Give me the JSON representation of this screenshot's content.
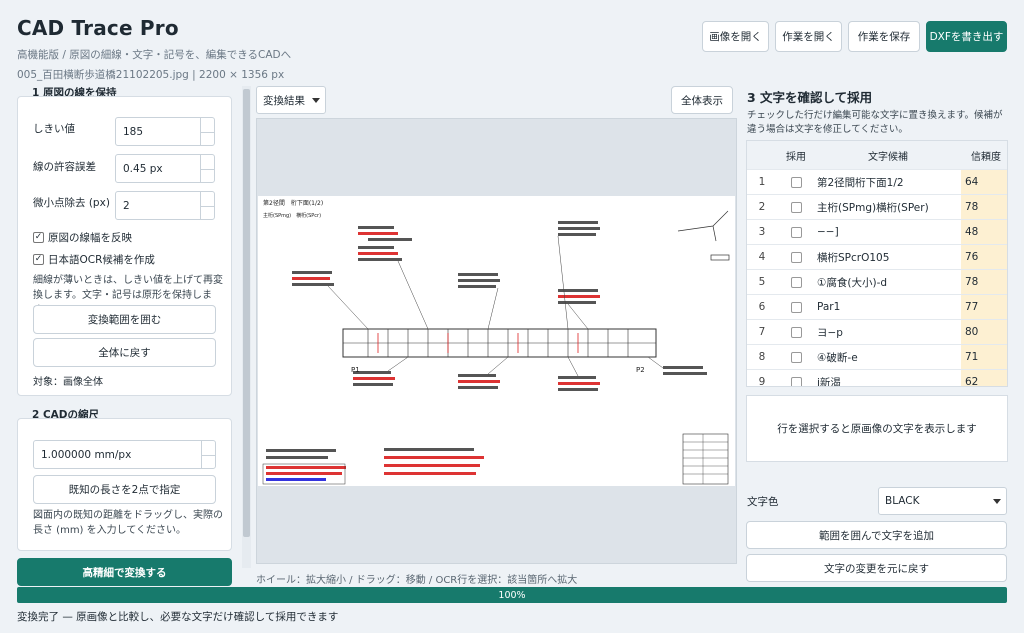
{
  "app": {
    "title": "CAD Trace Pro",
    "subtitle": "高機能版 / 原図の細線・文字・記号を、編集できるCADへ",
    "fileinfo": "005_百田横断歩道橋21102205.jpg | 2200 × 1356 px"
  },
  "toolbar": {
    "open_image": "画像を開く",
    "open_work": "作業を開く",
    "save_work": "作業を保存",
    "export_dxf": "DXFを書き出す"
  },
  "section1": {
    "title": "1 原図の線を保持",
    "threshold_label": "しきい値",
    "threshold_value": "185",
    "tolerance_label": "線の許容誤差",
    "tolerance_value": "0.45 px",
    "speck_label": "微小点除去 (px)",
    "speck_value": "2",
    "invert_label": "原図の線幅を反映",
    "ocr_label": "日本語OCR候補を作成",
    "note": "細線が薄いときは、しきい値を上げて再変換します。文字・記号は原形を保持します。",
    "select_region": "変換範囲を囲む",
    "reset_all": "全体に戻す",
    "target": "対象：画像全体"
  },
  "section2": {
    "title": "2 CADの縮尺",
    "scale_value": "1.000000 mm/px",
    "two_point": "既知の長さを2点で指定",
    "note": "図面内の既知の距離をドラッグし、実際の長さ (mm) を入力してください。"
  },
  "convert_button": "高精細で変換する",
  "viewer": {
    "mode": "変換結果",
    "fit": "全体表示",
    "hint": "ホイール：拡大縮小 / ドラッグ：移動 / OCR行を選択：該当箇所へ拡大"
  },
  "section3": {
    "title": "3 文字を確認して採用",
    "desc": "チェックした行だけ編集可能な文字に置き換えます。候補が違う場合は文字を修正してください。",
    "headers": {
      "adopt": "採用",
      "text": "文字候補",
      "conf": "信頼度"
    },
    "rows": [
      {
        "n": "1",
        "text": "第2径間桁下面1/2",
        "conf": "64"
      },
      {
        "n": "2",
        "text": "主桁(SPmg)横桁(SPer)",
        "conf": "78"
      },
      {
        "n": "3",
        "text": "−−]",
        "conf": "48"
      },
      {
        "n": "4",
        "text": "横桁SPcrO105",
        "conf": "76"
      },
      {
        "n": "5",
        "text": "①腐食(大小)-d",
        "conf": "78"
      },
      {
        "n": "6",
        "text": "Par1",
        "conf": "77"
      },
      {
        "n": "7",
        "text": "ヨ−p",
        "conf": "80"
      },
      {
        "n": "8",
        "text": "④破断-e",
        "conf": "71"
      },
      {
        "n": "9",
        "text": "i新渴",
        "conf": "62"
      }
    ],
    "preview_text": "行を選択すると原画像の文字を表示します",
    "color_label": "文字色",
    "color_value": "BLACK",
    "add_text": "範囲を囲んで文字を追加",
    "revert_text": "文字の変更を元に戻す"
  },
  "drawing_labels": {
    "sheet": "第2径間　桁下面(1/2)",
    "sub": "主桁(SPmg)　横桁(SPcr)",
    "p1": "P1",
    "p2": "P2"
  },
  "progress": {
    "label": "100%",
    "value": 1.0
  },
  "status": "変換完了 — 原画像と比較し、必要な文字だけ確認して採用できます",
  "colors": {
    "accent": "#177a6c",
    "conf_bg": "#fdf0d2"
  }
}
